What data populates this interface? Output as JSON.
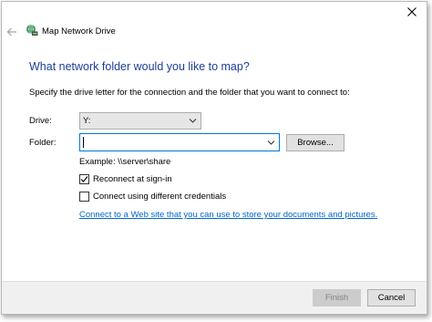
{
  "wizard": {
    "title": "Map Network Drive",
    "heading": "What network folder would you like to map?",
    "instruction": "Specify the drive letter for the connection and the folder that you want to connect to:"
  },
  "form": {
    "drive_label": "Drive:",
    "drive_value": "Y:",
    "folder_label": "Folder:",
    "folder_value": "",
    "browse_label": "Browse...",
    "example_text": "Example: \\\\server\\share",
    "reconnect_label": "Reconnect at sign-in",
    "reconnect_checked": true,
    "credentials_label": "Connect using different credentials",
    "credentials_checked": false,
    "web_link": "Connect to a Web site that you can use to store your documents and pictures."
  },
  "footer": {
    "finish_label": "Finish",
    "finish_enabled": false,
    "cancel_label": "Cancel"
  },
  "icons": {
    "close": "close-icon",
    "back": "back-arrow-icon",
    "wizard": "network-drive-icon",
    "dropdown": "chevron-down-icon",
    "check": "checkmark-icon"
  },
  "colors": {
    "heading": "#1c3e99",
    "link": "#0066cc",
    "focus_border": "#0078d7",
    "footer_bg": "#f0f0f0"
  }
}
